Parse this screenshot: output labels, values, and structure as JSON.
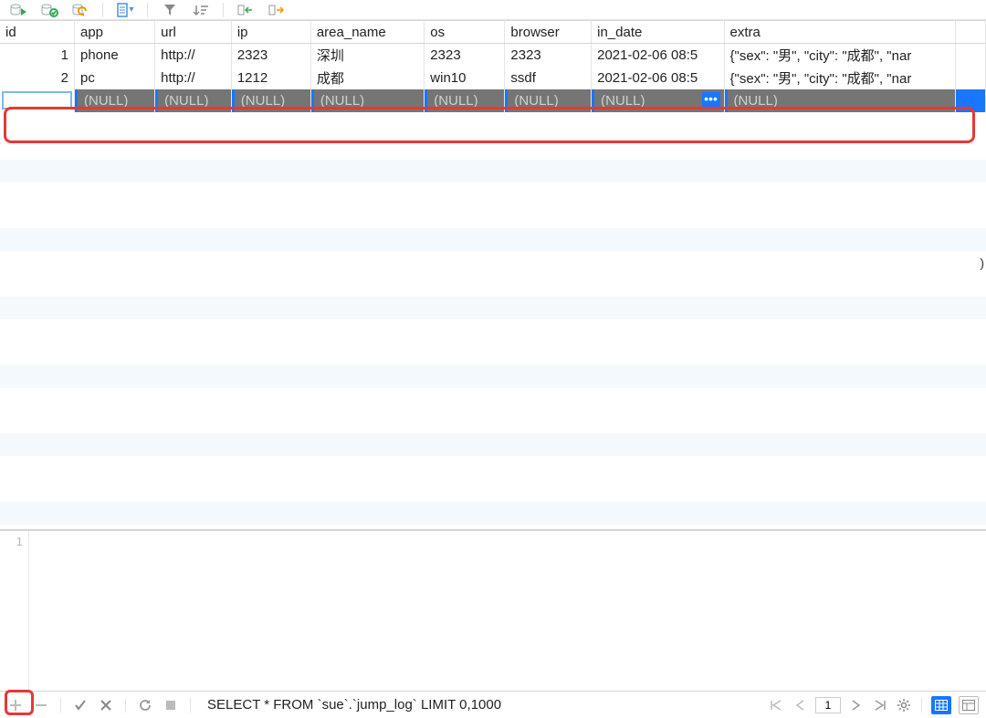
{
  "columns": {
    "id": "id",
    "app": "app",
    "url": "url",
    "ip": "ip",
    "area_name": "area_name",
    "os": "os",
    "browser": "browser",
    "in_date": "in_date",
    "extra": "extra"
  },
  "rows": [
    {
      "id": "1",
      "app": "phone",
      "url": "http://",
      "ip": "2323",
      "area_name": "深圳",
      "os": "2323",
      "browser": "2323",
      "in_date": "2021-02-06 08:5",
      "extra": "{\"sex\": \"男\", \"city\": \"成都\", \"nar"
    },
    {
      "id": "2",
      "app": "pc",
      "url": "http://",
      "ip": "1212",
      "area_name": "成都",
      "os": "win10",
      "browser": "ssdf",
      "in_date": "2021-02-06 08:5",
      "extra": "{\"sex\": \"男\", \"city\": \"成都\", \"nar"
    }
  ],
  "null_text": "(NULL)",
  "ellipsis": "•••",
  "script": {
    "line_no": "1"
  },
  "status": {
    "sql": "SELECT * FROM `sue`.`jump_log` LIMIT 0,1000",
    "page": "1"
  },
  "paren": ")"
}
